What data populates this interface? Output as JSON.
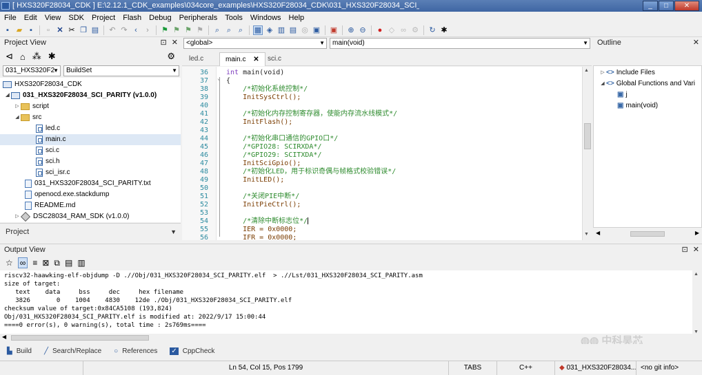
{
  "window": {
    "title": "[ HXS320F28034_CDK ] E:\\2.12.1_CDK_examples\\034core_examples\\HXS320F28034_CDK\\031_HXS320F28034_SCI_PARITY\\src\\main.c",
    "minimize": "_",
    "maximize": "□",
    "close": "✕"
  },
  "menu": [
    "File",
    "Edit",
    "View",
    "SDK",
    "Project",
    "Flash",
    "Debug",
    "Peripherals",
    "Tools",
    "Windows",
    "Help"
  ],
  "toolbar_icons": [
    "save-icon",
    "open-folder-icon",
    "save-all-icon",
    "disk-icon",
    "delete-icon",
    "cut-icon",
    "copy-icon",
    "paste-icon",
    "undo-icon",
    "redo-icon",
    "back-icon",
    "forward-icon",
    "flag-icon",
    "bookmark-icon",
    "bookmark-prev-icon",
    "bookmark-next-icon",
    "find-icon",
    "find-files-icon",
    "replace-icon",
    "grid-icon",
    "build-icon",
    "rebuild-icon",
    "clean-icon",
    "flash-icon",
    "download-icon",
    "debug-icon",
    "zoom-in-icon",
    "zoom-out-icon",
    "stop-icon",
    "breakpoint-icon",
    "link-icon",
    "settings-icon",
    "refresh-icon",
    "bug-icon"
  ],
  "project_view": {
    "title": "Project View",
    "pin": "⊡",
    "close": "✕",
    "target_combo": "031_HXS320F2",
    "config_combo": "BuildSet",
    "tree": [
      {
        "label": "HXS320F28034_CDK",
        "type": "proj",
        "bold": false
      },
      {
        "label": "031_HXS320F28034_SCI_PARITY (v1.0.0)",
        "type": "proj",
        "bold": true
      },
      {
        "label": "script",
        "type": "folder",
        "bold": false
      },
      {
        "label": "src",
        "type": "folder",
        "bold": false
      },
      {
        "label": "led.c",
        "type": "file",
        "bold": false
      },
      {
        "label": "main.c",
        "type": "file",
        "bold": false
      },
      {
        "label": "sci.c",
        "type": "file",
        "bold": false
      },
      {
        "label": "sci.h",
        "type": "file",
        "bold": false
      },
      {
        "label": "sci_isr.c",
        "type": "file",
        "bold": false
      },
      {
        "label": "031_HXS320F28034_SCI_PARITY.txt",
        "type": "txt",
        "bold": false
      },
      {
        "label": "openocd.exe.stackdump",
        "type": "txt",
        "bold": false
      },
      {
        "label": "README.md",
        "type": "txt",
        "bold": false
      },
      {
        "label": "DSC28034_RAM_SDK (v1.0.0)",
        "type": "sdk",
        "bold": false
      }
    ],
    "bottom_tab": "Project"
  },
  "editor": {
    "scope_combo": "<global>",
    "function_combo": "main(void)",
    "tabs": [
      {
        "label": "led.c",
        "active": false
      },
      {
        "label": "main.c",
        "active": true
      },
      {
        "label": "sci.c",
        "active": false
      }
    ],
    "tab_close": "✕",
    "line_numbers": [
      "36",
      "37",
      "38",
      "39",
      "40",
      "41",
      "42",
      "43",
      "44",
      "45",
      "46",
      "47",
      "48",
      "49",
      "50",
      "51",
      "52",
      "53",
      "54",
      "55",
      "56"
    ],
    "code": [
      {
        "t": "sig",
        "a": "int ",
        "b": "main(void)"
      },
      {
        "t": "plain",
        "a": "{"
      },
      {
        "t": "cm",
        "a": "    /*初始化系统控制*/"
      },
      {
        "t": "fn",
        "a": "    InitSysCtrl();"
      },
      {
        "t": "plain",
        "a": ""
      },
      {
        "t": "cm",
        "a": "    /*初始化内存控制寄存器，使能内存流水线模式*/"
      },
      {
        "t": "fn",
        "a": "    InitFlash();"
      },
      {
        "t": "plain",
        "a": ""
      },
      {
        "t": "cm",
        "a": "    /*初始化串口通信的GPIO口*/"
      },
      {
        "t": "cm",
        "a": "    /*GPIO28: SCIRXDA*/"
      },
      {
        "t": "cm",
        "a": "    /*GPIO29: SCITXDA*/"
      },
      {
        "t": "fn",
        "a": "    InitSciGpio();"
      },
      {
        "t": "cm",
        "a": "    /*初始化LED，用于标识奇偶与帧格式校验错误*/"
      },
      {
        "t": "fn",
        "a": "    InitLED();"
      },
      {
        "t": "plain",
        "a": ""
      },
      {
        "t": "cm",
        "a": "    /*关闭PIE中断*/"
      },
      {
        "t": "fn",
        "a": "    InitPieCtrl();"
      },
      {
        "t": "plain",
        "a": ""
      },
      {
        "t": "cm",
        "a": "    /*清除中断标志位*/"
      },
      {
        "t": "fn",
        "a": "    IER = 0x0000;"
      },
      {
        "t": "fn",
        "a": "    IFR = 0x0000;"
      }
    ]
  },
  "outline": {
    "title": "Outline",
    "close": "✕",
    "items": [
      {
        "label": "Include Files",
        "indent": 0,
        "icon": "<>",
        "twisty": "▷"
      },
      {
        "label": "Global Functions and Vari",
        "indent": 0,
        "icon": "<>",
        "twisty": "◢"
      },
      {
        "label": "j",
        "indent": 1,
        "icon": "▣",
        "twisty": ""
      },
      {
        "label": "main(void)",
        "indent": 1,
        "icon": "▣",
        "twisty": ""
      }
    ]
  },
  "output": {
    "title": "Output View",
    "pin": "⊡",
    "close": "✕",
    "lines": [
      "riscv32-haawking-elf-objdump -D .//Obj/031_HXS320F28034_SCI_PARITY.elf  > .//Lst/031_HXS320F28034_SCI_PARITY.asm",
      "size of target:",
      "   text    data     bss     dec     hex filename",
      "   3826       0    1004    4830    12de ./Obj/031_HXS320F28034_SCI_PARITY.elf",
      "checksum value of target:0x84CA5108 (193,824)",
      "Obj/031_HXS320F28034_SCI_PARITY.elf is modified at: 2022/9/17 15:00:44",
      "====0 error(s), 0 warning(s), total time : 2s769ms===="
    ]
  },
  "bottom_tabs": [
    {
      "label": "Build",
      "icon": "build-tab-icon"
    },
    {
      "label": "Search/Replace",
      "icon": "search-replace-tab-icon"
    },
    {
      "label": "References",
      "icon": "references-tab-icon"
    },
    {
      "label": "CppCheck",
      "icon": "cppcheck-tab-icon"
    }
  ],
  "status": {
    "position": "Ln 54, Col 15, Pos 1799",
    "tabs": "TABS",
    "language": "C++",
    "project": "031_HXS320F28034...",
    "git": "<no git info>"
  },
  "watermark": "中科昊芯"
}
